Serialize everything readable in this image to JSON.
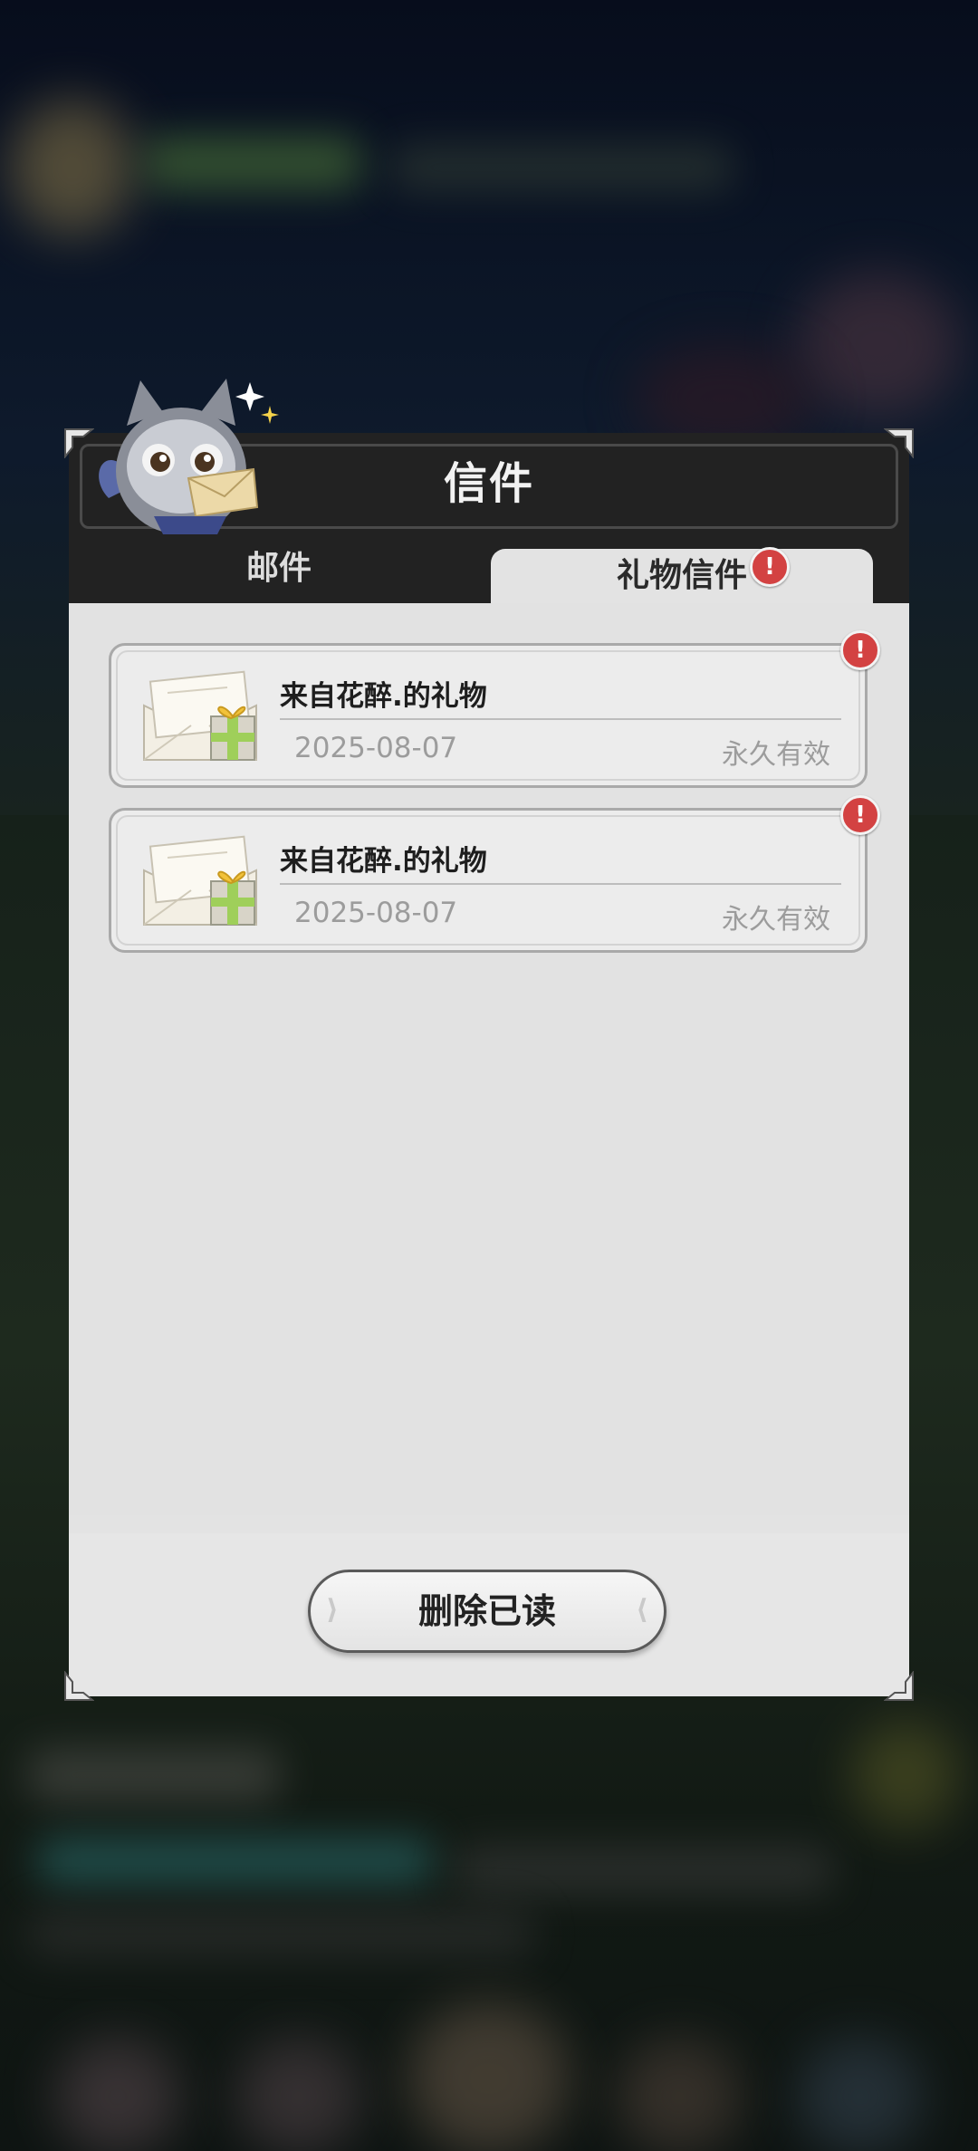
{
  "dialog": {
    "title": "信件",
    "tabs": [
      {
        "label": "邮件",
        "active": false
      },
      {
        "label": "礼物信件",
        "active": true,
        "badge": "!"
      }
    ],
    "mails": [
      {
        "title": "来自花醉.的礼物",
        "date": "2025-08-07",
        "expiry": "永久有效",
        "badge": "!"
      },
      {
        "title": "来自花醉.的礼物",
        "date": "2025-08-07",
        "expiry": "永久有效",
        "badge": "!"
      }
    ],
    "delete_read_label": "删除已读"
  },
  "colors": {
    "header_bg": "#222222",
    "panel_bg": "#e3e3e3",
    "badge_red": "#d34242"
  },
  "icons": [
    "owl-mascot-icon",
    "envelope-gift-icon",
    "alert-badge-icon",
    "corner-ornament-icon",
    "sparkle-icon"
  ]
}
